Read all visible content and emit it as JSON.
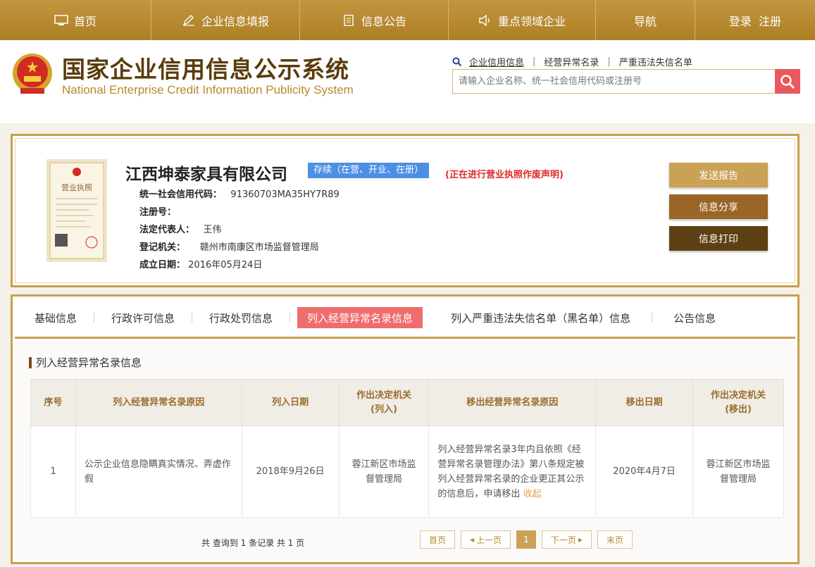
{
  "nav": {
    "items": [
      {
        "label": "首页",
        "icon": "monitor-icon"
      },
      {
        "label": "企业信息填报",
        "icon": "pen-icon"
      },
      {
        "label": "信息公告",
        "icon": "document-icon"
      },
      {
        "label": "重点领域企业",
        "icon": "speaker-icon"
      },
      {
        "label": "导航",
        "icon": ""
      },
      {
        "label": "登录  注册",
        "icon": ""
      }
    ]
  },
  "header": {
    "title": "国家企业信用信息公示系统",
    "subtitle": "National Enterprise Credit Information Publicity System",
    "quick_links": [
      "企业信用信息",
      "经营异常名录",
      "严重违法失信名单"
    ],
    "search_placeholder": "请输入企业名称、统一社会信用代码或注册号"
  },
  "company": {
    "name": "江西坤泰家具有限公司",
    "status": "存续（在营、开业、在册）",
    "notice": "(正在进行营业执照作废声明)",
    "fields": [
      {
        "label": "统一社会信用代码：",
        "value": "91360703MA35HY7R89"
      },
      {
        "label": "注册号：",
        "value": ""
      },
      {
        "label": "法定代表人：",
        "value": "王伟"
      },
      {
        "label": "登记机关：",
        "value": "赣州市南康区市场监督管理局"
      },
      {
        "label": "成立日期：",
        "value": "2016年05月24日"
      }
    ],
    "license_label": "营业执照",
    "buttons": [
      "发送报告",
      "信息分享",
      "信息打印"
    ]
  },
  "tabs": [
    {
      "label": "基础信息",
      "active": false
    },
    {
      "label": "行政许可信息",
      "active": false
    },
    {
      "label": "行政处罚信息",
      "active": false
    },
    {
      "label": "列入经营异常名录信息",
      "active": true
    },
    {
      "label": "列入严重违法失信名单（黑名单）信息",
      "active": false
    },
    {
      "label": "公告信息",
      "active": false
    }
  ],
  "section": {
    "title": "列入经营异常名录信息",
    "columns": [
      "序号",
      "列入经营异常名录原因",
      "列入日期",
      "作出决定机关(列入)",
      "移出经营异常名录原因",
      "移出日期",
      "作出决定机关(移出)"
    ],
    "rows": [
      {
        "index": "1",
        "reason_in": "公示企业信息隐瞒真实情况、弄虚作假",
        "date_in": "2018年9月26日",
        "org_in": "蓉江新区市场监督管理局",
        "reason_out": "列入经营异常名录3年内且依照《经营异常名录管理办法》第八条规定被列入经营异常名录的企业更正其公示的信息后，申请移出",
        "reason_out_more": "收起",
        "date_out": "2020年4月7日",
        "org_out": "蓉江新区市场监督管理局"
      }
    ],
    "total_text": "共 查询到 1 条记录 共 1 页",
    "pager": [
      "首页",
      "上一页",
      "1",
      "下一页",
      "末页"
    ]
  },
  "colors": {
    "nav_gold": "#b8892d",
    "title_brown": "#5a3b0c",
    "active_tab": "#f06d6d",
    "status_blue": "#4c8fe6",
    "notice_red": "#e02b2b"
  }
}
